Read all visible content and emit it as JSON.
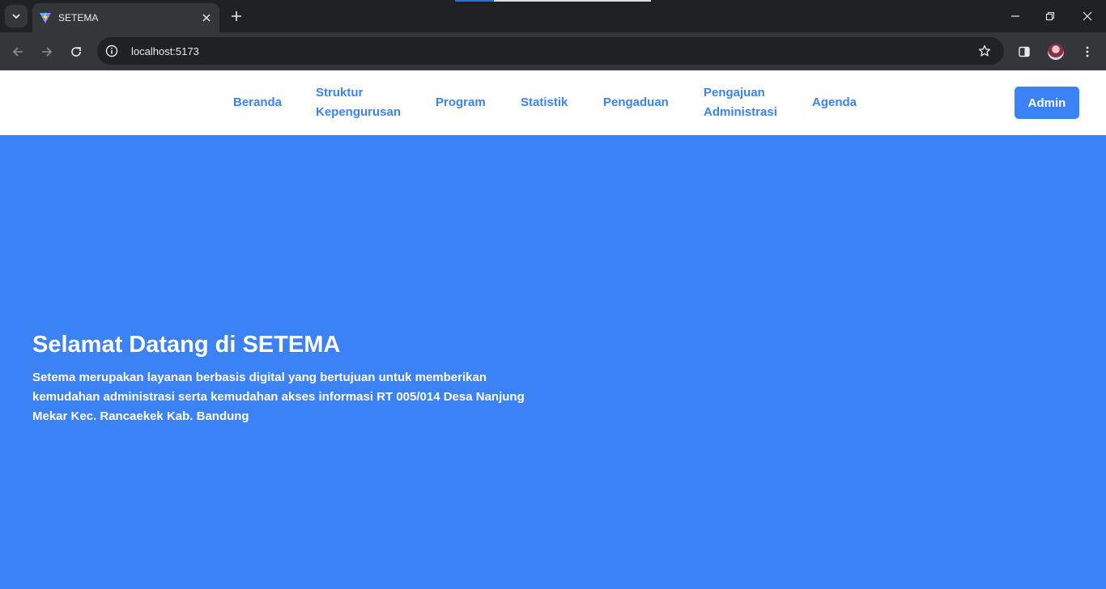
{
  "browser": {
    "tab": {
      "title": "SETEMA"
    },
    "address": {
      "url": "localhost:5173"
    }
  },
  "nav": {
    "items": [
      {
        "lines": [
          "Beranda"
        ]
      },
      {
        "lines": [
          "Struktur",
          "Kepengurusan"
        ]
      },
      {
        "lines": [
          "Program"
        ]
      },
      {
        "lines": [
          "Statistik"
        ]
      },
      {
        "lines": [
          "Pengaduan"
        ]
      },
      {
        "lines": [
          "Pengajuan",
          "Administrasi"
        ]
      },
      {
        "lines": [
          "Agenda"
        ]
      }
    ],
    "admin_label": "Admin"
  },
  "hero": {
    "title": "Selamat Datang di SETEMA",
    "description_lines": [
      "Setema merupakan layanan berbasis digital yang bertujuan untuk memberikan",
      "kemudahan administrasi serta kemudahan akses informasi RT 005/014 Desa Nanjung",
      "Mekar Kec. Rancaekek Kab. Bandung"
    ]
  },
  "colors": {
    "accent": "#3b82f6",
    "chrome_dark": "#202124",
    "chrome_tab": "#35363a"
  }
}
